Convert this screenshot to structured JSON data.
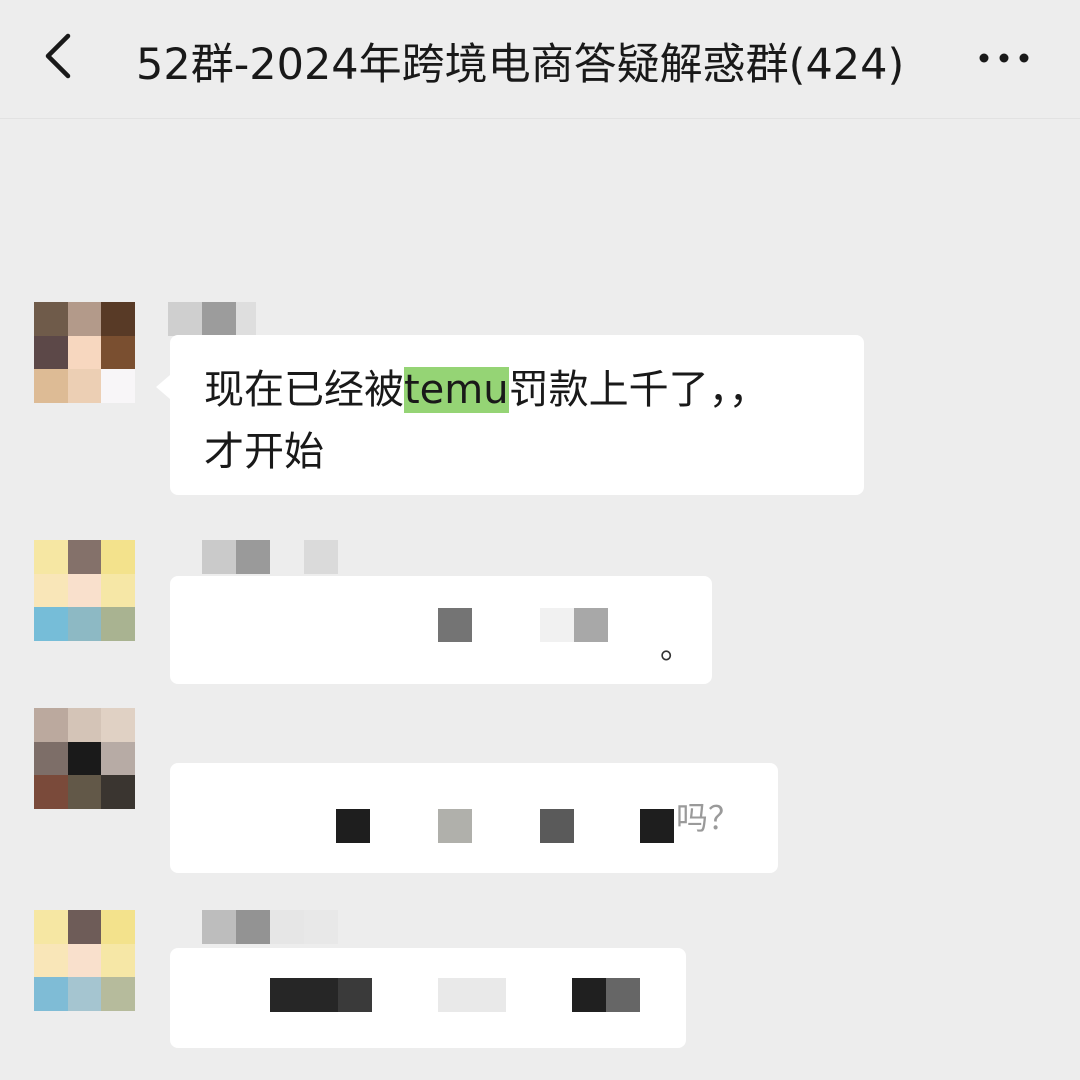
{
  "header": {
    "title": "52群-2024年跨境电商答疑解惑群(424)",
    "back_icon": "chevron-left-icon",
    "more_icon": "ellipsis-icon"
  },
  "messages": [
    {
      "text_pre": "现在已经被",
      "text_highlight": "temu",
      "text_post": "罚款上千了，，",
      "text_line2": "才开始"
    },
    {
      "trailing": "。"
    },
    {
      "trailing": "吗？"
    },
    {
      "trailing": ""
    }
  ],
  "colors": {
    "background": "#ededed",
    "bubble": "#ffffff",
    "highlight": "#95d475",
    "text": "#191919"
  }
}
